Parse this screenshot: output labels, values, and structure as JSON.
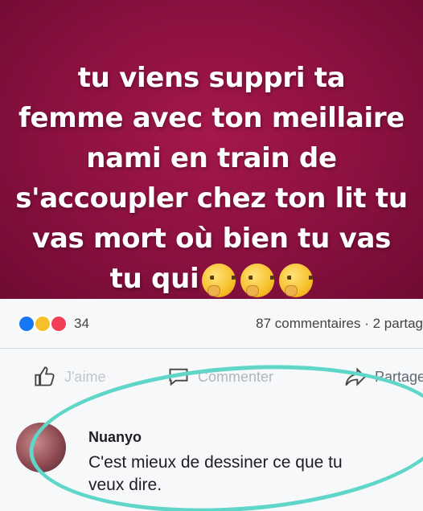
{
  "post": {
    "text": "tu viens suppri ta\nfemme avec ton meillaire\nnami en train de\ns'accoupler chez ton lit tu\nvas mort où bien tu vas\ntu qui",
    "emojis": [
      "thinking-face",
      "thinking-face",
      "thinking-face"
    ],
    "background_color": "#8a1040"
  },
  "meta": {
    "reaction_count": "34",
    "comments_shares": "87 commentaires · 2 partag"
  },
  "actions": {
    "like_label": "J'aime",
    "comment_label": "Commenter",
    "share_label": "Partage"
  },
  "comment": {
    "author": "Nuanyo",
    "text": "C'est mieux de dessiner ce que tu veux dire."
  },
  "colors": {
    "highlight": "#5fd6c8",
    "like_blue": "#1877f2"
  }
}
